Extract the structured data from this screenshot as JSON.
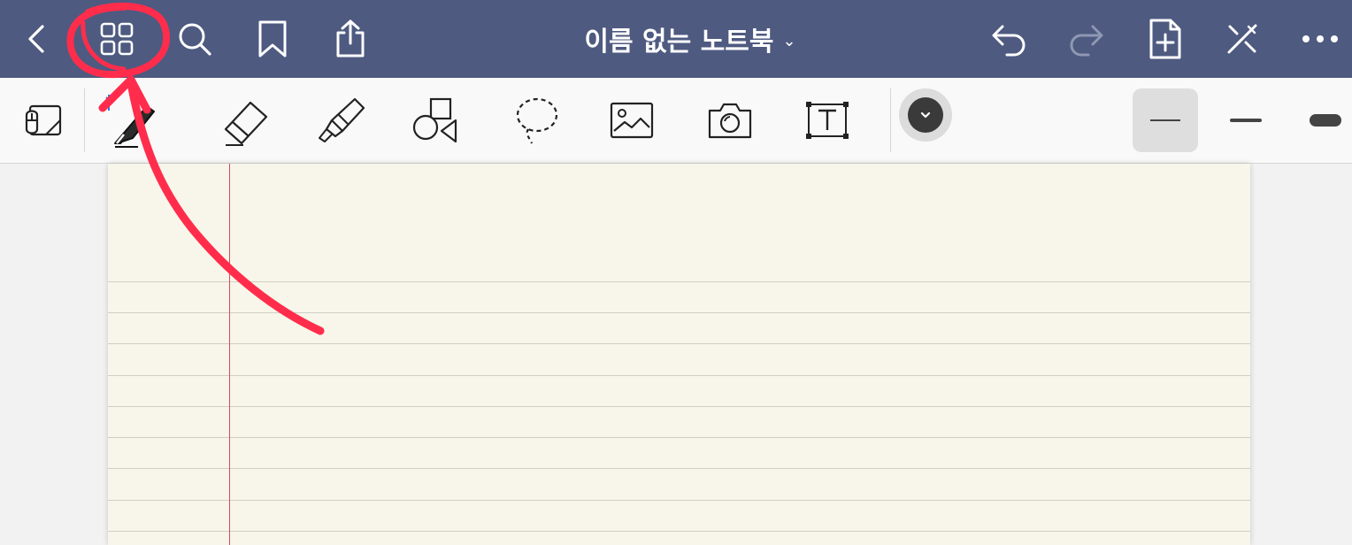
{
  "app": {
    "notebook_title": "이름 없는 노트북",
    "colors": {
      "nav_bar": "#4e5a80",
      "toolbar_bg": "#f9f9f9",
      "paper": "#f8f6ea",
      "margin_line": "#d9485a",
      "annotation": "#ff2d4b"
    }
  },
  "nav": {
    "left_icons": [
      "chevron-left-icon",
      "grid-icon",
      "search-icon",
      "bookmark-icon",
      "share-icon"
    ],
    "right_icons": [
      "undo-icon",
      "redo-icon",
      "add-page-icon",
      "close-toolbar-icon",
      "more-icon"
    ],
    "title_dropdown_glyph": "⌄"
  },
  "toolbar": {
    "tools": [
      "read-only-mode-icon",
      "pen-icon",
      "eraser-icon",
      "highlighter-icon",
      "shapes-icon",
      "lasso-icon",
      "image-icon",
      "camera-icon",
      "text-box-icon"
    ],
    "bluetooth_icon": "bluetooth-icon",
    "colors": [
      "#3a3a3a",
      "#de7f7f",
      "#9c2224"
    ],
    "selected_color": "#3a3a3a",
    "stroke_widths": [
      "thin",
      "medium",
      "thick"
    ],
    "selected_width": "thin"
  }
}
